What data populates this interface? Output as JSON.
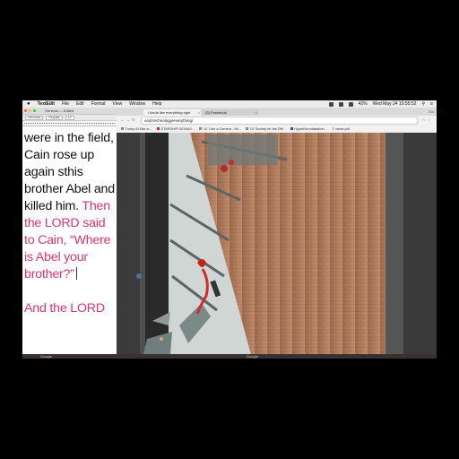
{
  "menubar": {
    "app_name": "TextEdit",
    "items": [
      "File",
      "Edit",
      "Format",
      "View",
      "Window",
      "Help"
    ],
    "status": {
      "battery": "42%",
      "datetime": "Wed May 24  10:55:52"
    }
  },
  "editor": {
    "title": "Genesis — Edited",
    "font_family_field": "Helvetica",
    "font_style_field": "Regular",
    "font_size_field": "12",
    "text_black": "were in the field, Cain rose up again sthis brother Abel and killed him.",
    "text_pink_1": "Then the LORD said to Cain, “Where is Abel your brother?”",
    "text_pink_2": "And the LORD"
  },
  "browser": {
    "tabs": [
      {
        "label": "I kinda like everything.right"
      },
      {
        "label": "(3) Facebook"
      }
    ],
    "user_label": "Tim",
    "url": "void.technology/everything/",
    "bookmarks": [
      "Trump At Mar-a-...",
      "STARSHIP GENIUS...",
      "'Ui' I Am a Camera - Wi...",
      "'Ui' Society for the Diff...",
      "HyperNormalisation...",
      "carse.pdf"
    ]
  },
  "dock": {
    "left_label": "Google",
    "right_label": "Google"
  },
  "colors": {
    "pink_text": "#e0336e",
    "wall": "#b07a5c"
  }
}
